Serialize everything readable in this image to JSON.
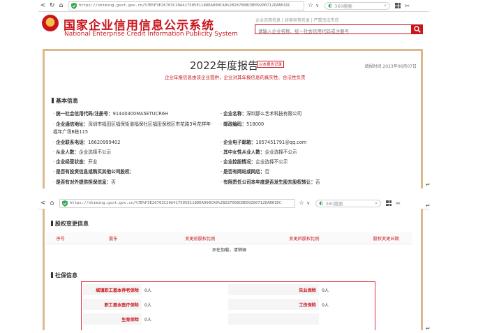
{
  "browser": {
    "url": "https://shiming.gsxt.gov.cn/%7B%F3E26703C20A417505E118DDA000CA0%2B287008CBE09200712DAB01DC",
    "url2": "https://shiming.gsxt.gov.cn/%7B%F3E26703C20A417505E118DDA000CA0%2B287008CBE09200712DAB01DC",
    "search_placeholder": "360搜索"
  },
  "site": {
    "title_cn": "国家企业信用信息公示系统",
    "title_en": "National Enterprise Credit Information Publicity System",
    "top_links": "企业信用信息 | 经营异常名录 | 严重违法失信",
    "search_placeholder": "请输入企业名称、统一社会信用代码或注册号"
  },
  "report": {
    "title": "2022年度报告",
    "badge": "以本报告记录",
    "fill_date": "填报时间:2023年06月07日",
    "disclaimer": "企业年报信息由该企业提供，企业对其年报信息的真实性、合法性负责"
  },
  "basic": {
    "section_title": "基本信息",
    "fields": [
      {
        "key": "统一社会信用代码/注册号：",
        "value": "91440300MA5ETUCR6H"
      },
      {
        "key": "企业名称：",
        "value": "深圳那么艺术科技有限公司"
      },
      {
        "key": "企业通信地址：",
        "value": "深圳市福田区福保街道福保社区福田保税区市花路3号花样年·"
      },
      {
        "key": "",
        "value": "福年广场B栋115"
      },
      {
        "key": "邮政编码：",
        "value": "518000"
      },
      {
        "key": "企业联系电话：",
        "value": "16620999402"
      },
      {
        "key": "企业电子邮箱：",
        "value": "1057451791@qq.com"
      },
      {
        "key": "从业人数：",
        "value": "企业选择不公示"
      },
      {
        "key": "其中女性从业人数：",
        "value": "企业选择不公示"
      },
      {
        "key": "企业经营状态：",
        "value": "开业"
      },
      {
        "key": "企业控股情况：",
        "value": "企业选择不公示"
      },
      {
        "key": "是否有投资信息或购买其他公司股权：",
        "value": ""
      },
      {
        "key": "是否有网站或网店：",
        "value": "否"
      },
      {
        "key": "是否有对外提供担保信息：",
        "value": "否"
      },
      {
        "key": "有限责任公司本年度是否发生股东股权转让：",
        "value": "否"
      }
    ]
  },
  "equity": {
    "section_title": "股权变更信息",
    "columns": [
      "序号",
      "股东",
      "变更前股权比例",
      "变更后股权比例",
      "股权变更日期"
    ],
    "loading": "正在加载，请稍候"
  },
  "social": {
    "section_title": "社保信息",
    "rows": [
      {
        "l1": "城镇职工基本养老保险",
        "v1": "0人",
        "l2": "失业保险",
        "v2": "0人"
      },
      {
        "l1": "职工基本医疗保险",
        "v1": "0人",
        "l2": "工伤保险",
        "v2": "0人"
      },
      {
        "l1": "生育保险",
        "v1": "0人",
        "l2": "",
        "v2": ""
      }
    ]
  },
  "return_mark": "↵"
}
